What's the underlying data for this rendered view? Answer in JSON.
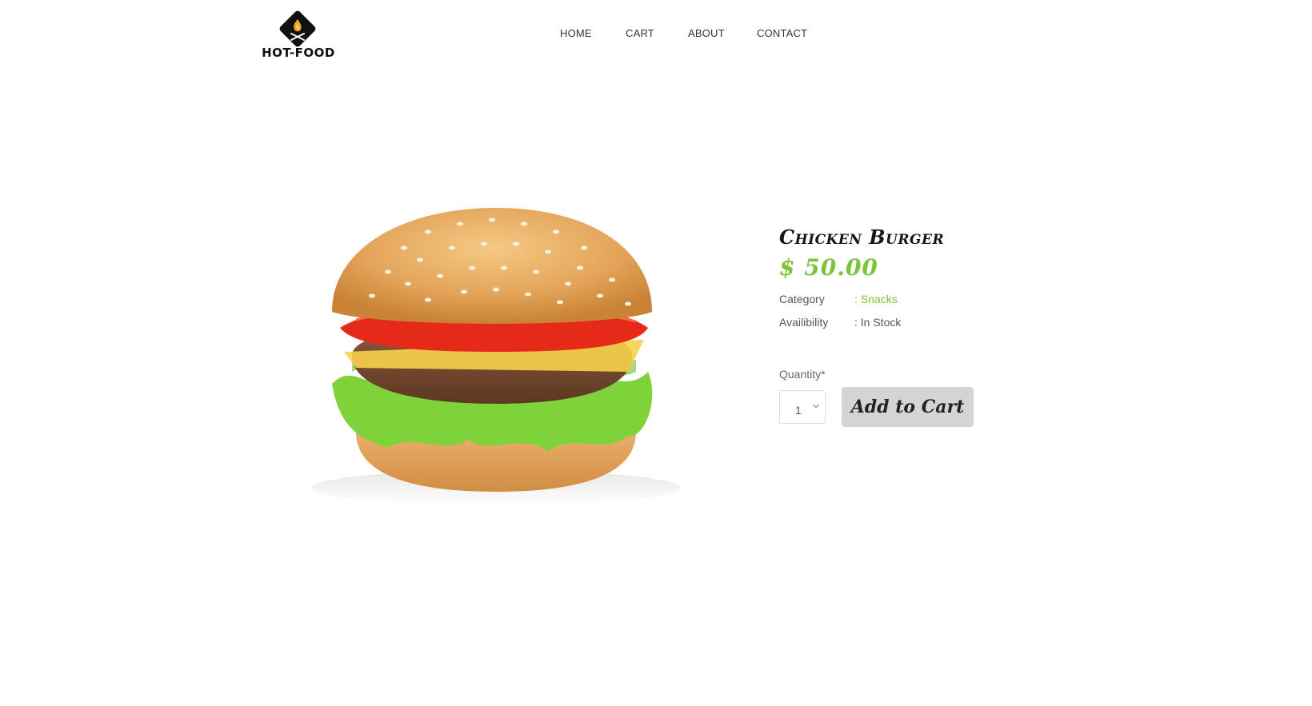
{
  "brand": {
    "logo_text": "HOT-FOOD",
    "logo_icon": "flame-utensils-icon"
  },
  "nav": {
    "items": [
      {
        "label": "HOME"
      },
      {
        "label": "CART"
      },
      {
        "label": "ABOUT"
      },
      {
        "label": "CONTACT"
      }
    ]
  },
  "product": {
    "image_alt": "burger-image",
    "title": "Chicken Burger",
    "price": "$ 50.00",
    "category_label": "Category",
    "category_value": ": Snacks",
    "availability_label": "Availibility",
    "availability_value": ": In Stock",
    "quantity_label": "Quantity*",
    "quantity_value": "1",
    "add_to_cart_label": "Add to Cart"
  },
  "colors": {
    "accent_green": "#7cc33a",
    "button_gray": "#d4d4d4",
    "text_dark": "#151515"
  }
}
